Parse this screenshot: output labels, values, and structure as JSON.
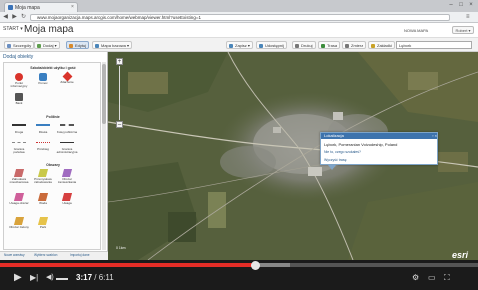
{
  "browser": {
    "tab_title": "Moja mapa",
    "url": "www.mojaorganizacja.maps.arcgis.com/home/webmap/viewer.html?useExisting=1",
    "tab_close": "×",
    "win_min": "–",
    "win_max": "□",
    "win_close": "×",
    "back_icon": "◀",
    "forward_icon": "▶",
    "reload_icon": "↻",
    "menu_icon": "≡"
  },
  "app": {
    "start": "START ▾",
    "title": "Moja mapa",
    "header_links": [
      "NOWA MAPA"
    ],
    "user": "Robert ▾"
  },
  "toolbar": {
    "left": [
      {
        "label": "Szczegóły",
        "icon": "details-icon",
        "color": "#6b8fc2"
      },
      {
        "label": "Dodaj ▾",
        "icon": "add-icon",
        "color": "#5f9f4f"
      },
      {
        "label": "Edytuj",
        "icon": "edit-icon",
        "color": "#d88a2b",
        "active": true
      },
      {
        "label": "Mapa bazowa ▾",
        "icon": "basemap-icon",
        "color": "#4b86b9"
      }
    ],
    "right": [
      {
        "label": "Zapisz ▾",
        "icon": "save-icon",
        "color": "#4b86b9"
      },
      {
        "label": "Udostępnij",
        "icon": "share-icon",
        "color": "#4b86b9"
      },
      {
        "label": "Drukuj",
        "icon": "print-icon",
        "color": "#777777"
      },
      {
        "label": "Trasa",
        "icon": "route-icon",
        "color": "#3b8c3b"
      },
      {
        "label": "Zmierz",
        "icon": "measure-icon",
        "color": "#777777"
      },
      {
        "label": "Zakładki",
        "icon": "bookmark-icon",
        "color": "#c9a227"
      }
    ],
    "search_value": "Lębork"
  },
  "panel": {
    "title": "Dodaj obiekty",
    "sections": {
      "points": {
        "title": "Szkoła/obiekt użytku i gość",
        "items": [
          {
            "label": "Punkt informacyjny",
            "color": "#d9342b"
          },
          {
            "label": "Pomoc",
            "color": "#3a7fc1"
          },
          {
            "label": "Zdarzenie",
            "color": "#d9342b"
          },
          {
            "label": "Bank",
            "color": "#555555"
          }
        ]
      },
      "lines": {
        "title": "Polilinie",
        "items": [
          {
            "label": "Droga",
            "color": "#333333"
          },
          {
            "label": "Rzeka",
            "color": "#3a7fc1"
          },
          {
            "label": "Kolej publiczna",
            "color": "#555555"
          },
          {
            "label": "Granica państwa",
            "color": "#888888"
          },
          {
            "label": "Przebieg",
            "color": "#cc3333"
          },
          {
            "label": "Granica administracyjna",
            "color": "#333333"
          }
        ]
      },
      "areas": {
        "title": "Obszary",
        "items": [
          {
            "label": "Zabudowa mieszkaniowa",
            "color": "#c96a6a"
          },
          {
            "label": "Przemysłowe zabudowania",
            "color": "#c9c94a"
          },
          {
            "label": "Obszar zamieszkania",
            "color": "#a06cc0"
          },
          {
            "label": "Uwaga obszar",
            "color": "#cf5f9a"
          },
          {
            "label": "Woda",
            "color": "#c96a3a"
          },
          {
            "label": "Uwaga",
            "color": "#d64040"
          },
          {
            "label": "Obszar zielony",
            "color": "#d9a33c"
          },
          {
            "label": "Park",
            "color": "#e6c34a"
          }
        ]
      }
    },
    "footer_links": [
      "Nowe warstwy",
      "Wybierz szablon",
      "Importuj dane"
    ]
  },
  "map": {
    "scale_label": "0    1km",
    "logo": "esri",
    "zoom_in": "+",
    "zoom_out": "–"
  },
  "popup": {
    "title": "Lokalizacja",
    "close": "▫ ×",
    "address": "Lębork, Pomeranian Voivodeship, Poland",
    "question": "Nie to, czego szukałeś?",
    "action": "Wyczyść trasę"
  },
  "player": {
    "current": "3:17",
    "duration": "/ 6:11",
    "progress_fraction": 0.534,
    "buffered_fraction": 0.607,
    "play_icon": "▶",
    "next_icon": "▶|",
    "volume_icon": "◀)",
    "cc_icon": "⚙",
    "fullscreen_icon": "⛶",
    "size_icon": "▭",
    "settings_icon": "⚙"
  }
}
